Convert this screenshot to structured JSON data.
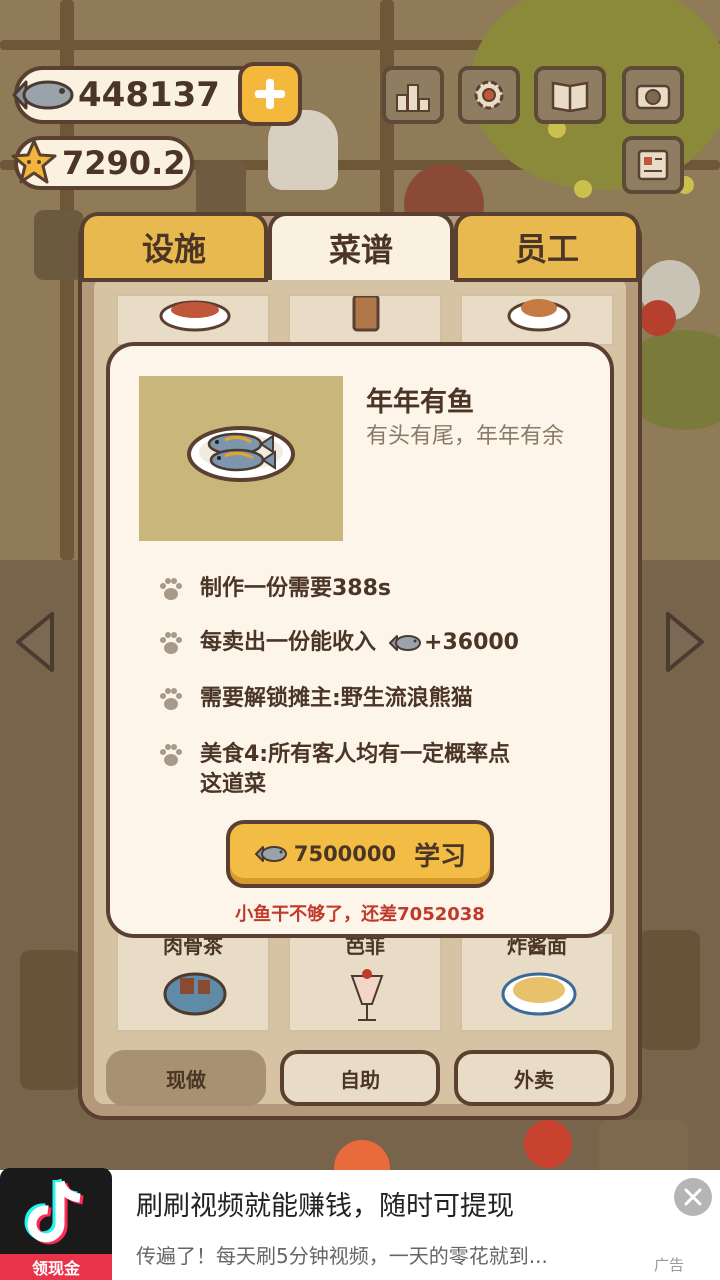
{
  "hud": {
    "fish_count": "448137",
    "star_count": "7290.2",
    "buttons": [
      "rank-icon",
      "settings-icon",
      "book-icon",
      "camera-icon",
      "notice-icon"
    ]
  },
  "tabs": [
    "设施",
    "菜谱",
    "员工"
  ],
  "active_tab": "菜谱",
  "grid_labels": [
    "肉骨茶",
    "芭菲",
    "炸酱面"
  ],
  "mode_buttons": [
    "现做",
    "自助",
    "外卖"
  ],
  "recipe": {
    "name": "年年有鱼",
    "description": "有头有尾，年年有余",
    "info": [
      "制作一份需要388s",
      "每卖出一份能收入",
      "需要解锁摊主:野生流浪熊猫",
      "美食4:所有客人均有一定概率点",
      "这道菜"
    ],
    "income": "+36000",
    "cost": "7500000",
    "learn_label": "学习",
    "warning": "小鱼干不够了，还差7052038"
  },
  "ad": {
    "app_badge": "领现金",
    "title": "刷刷视频就能赚钱，随时可提现",
    "description": "传遍了！每天刷5分钟视频，一天的零花就到...",
    "label": "广告"
  },
  "colors": {
    "panel_border": "#5a4030",
    "accent_yellow": "#f3bd45",
    "tab_yellow": "#e7b94e",
    "cream": "#fdf5ea",
    "warning_red": "#c0392b",
    "ad_badge_red": "#e8334a"
  }
}
